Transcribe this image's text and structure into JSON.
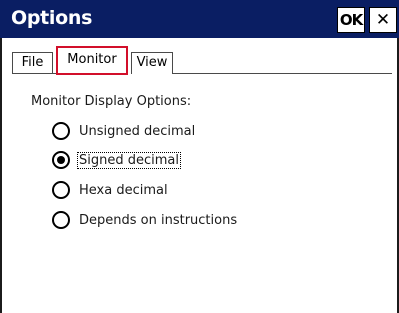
{
  "window": {
    "title": "Options",
    "ok_label": "OK",
    "close_label": "✕"
  },
  "tabs": [
    {
      "label": "File",
      "selected": false
    },
    {
      "label": "Monitor",
      "selected": true
    },
    {
      "label": "View",
      "selected": false
    }
  ],
  "monitor": {
    "group_label": "Monitor Display Options:",
    "options": [
      {
        "label": "Unsigned decimal",
        "checked": false
      },
      {
        "label": "Signed decimal",
        "checked": true
      },
      {
        "label": "Hexa decimal",
        "checked": false
      },
      {
        "label": "Depends on instructions",
        "checked": false
      }
    ]
  },
  "colors": {
    "titlebar": "#0a1e63",
    "highlight": "#d20f2a"
  }
}
